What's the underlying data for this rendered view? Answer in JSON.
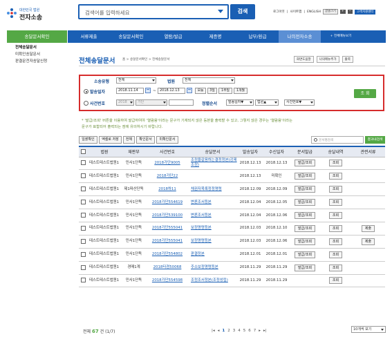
{
  "header": {
    "logo_small": "대한민국 법원",
    "logo_main": "전자소송",
    "search_placeholder": "검색어를 입력하세요",
    "search_button": "검색",
    "util_links": [
      "로그아웃",
      "사이트맵",
      "ENGLISH"
    ],
    "font_size_label": "글꼴크기",
    "font_plus": "+",
    "font_minus": "−",
    "customer_center": "고객지원센터"
  },
  "nav": {
    "items": [
      "서류제출",
      "송달문서확인",
      "열람/발급",
      "제증명",
      "납부/환급",
      "나의전자소송",
      "+ 전체메뉴보기"
    ],
    "active_index": 5
  },
  "sidebar": {
    "header": "송달문서확인",
    "items": [
      "전체송달문서",
      "미확인송달문서",
      "판결문전자송달신청"
    ],
    "current_index": 0
  },
  "page": {
    "title": "전체송달문서",
    "breadcrumb": "홈 > 송달문서확인 > 전체송달문서",
    "tools": [
      "화면도움말",
      "나의메뉴추가",
      "출력"
    ]
  },
  "filter": {
    "case_type_label": "소송유형",
    "case_type_value": "전체",
    "court_label": "법원",
    "court_value": "전체",
    "date_label": "발송일자",
    "date_from": "2018.11.14",
    "date_to": "2018.12.13",
    "date_sep": "~",
    "range_buttons": [
      "오늘",
      "3일",
      "1주일",
      "1개월"
    ],
    "case_no_label": "사건번호",
    "year_value": "2018",
    "case_kind_value": "가단",
    "sort_label": "정렬순서",
    "sort_options": [
      "발송일자▼",
      "법원▲",
      "사건번호▼"
    ],
    "lookup_button": "조 회"
  },
  "notice": [
    "* '발급/조회' 버튼을 이용하여 발급하여야 '열람용'이라는 문구가 기재되지 않은 등본을 출력할 수 있고, 그렇지 않은 경우는 '열람용'이라는",
    "  문구가 표함되어 출력되는 점에 유의하시기 바랍니다."
  ],
  "actions": {
    "buttons": [
      "일괄확인",
      "엑셀로 저장",
      "전체",
      "확인문서",
      "미확인문서"
    ],
    "search_placeholder": "문서명검색",
    "result_search": "결과내검색"
  },
  "table": {
    "headers": [
      "",
      "법원",
      "재판부",
      "사건번호",
      "송달문서",
      "발송일자",
      "수신일자",
      "문서발급",
      "송달내역",
      "관련서류"
    ],
    "issue_label": "발급/조회",
    "view_label": "조회",
    "submit_label": "제출",
    "rows": [
      {
        "court": "테스트테스트법원1",
        "division": "민사1단독",
        "case_no": "2018가단9005",
        "doc": "조정을갈음하는결정정본(강제조정)",
        "sent": "2018.12.13",
        "recv": "2018.12.13",
        "issue": true,
        "submit": false
      },
      {
        "court": "테스트테스트법원1",
        "division": "민사1단독",
        "case_no": "2018가단22",
        "doc": "",
        "sent": "2018.12.13",
        "recv": "미확인",
        "issue": true,
        "submit": false
      },
      {
        "court": "테스트테스트법원1",
        "division": "제1파산단독",
        "case_no": "2018하11",
        "doc": "채권자목록정정명령",
        "sent": "2018.12.09",
        "recv": "2018.12.09",
        "issue": true,
        "submit": false
      },
      {
        "court": "테스트테스트법원1",
        "division": "민사1단독",
        "case_no": "2018가단554619",
        "doc": "변론조서등본",
        "sent": "2018.12.04",
        "recv": "2018.12.05",
        "issue": true,
        "submit": false
      },
      {
        "court": "테스트테스트법원1",
        "division": "민사1단독",
        "case_no": "2018가단539100",
        "doc": "변론조서등본",
        "sent": "2018.12.04",
        "recv": "2018.12.06",
        "issue": true,
        "submit": false
      },
      {
        "court": "테스트테스트법원1",
        "division": "민사1단독",
        "case_no": "2018가단555041",
        "doc": "보정명령등본",
        "sent": "2018.12.03",
        "recv": "2018.12.10",
        "issue": true,
        "submit": true
      },
      {
        "court": "테스트테스트법원1",
        "division": "민사1단독",
        "case_no": "2018가단555041",
        "doc": "보정명령등본",
        "sent": "2018.12.03",
        "recv": "2018.12.06",
        "issue": true,
        "submit": true
      },
      {
        "court": "테스트테스트법원1",
        "division": "민사1단독",
        "case_no": "2018가단554802",
        "doc": "판결정본",
        "sent": "2018.12.01",
        "recv": "2018.12.01",
        "issue": true,
        "submit": false
      },
      {
        "court": "테스트테스트법원1",
        "division": "경매1계",
        "case_no": "2018타경50068",
        "doc": "주소보정명령등본",
        "sent": "2018.11.29",
        "recv": "2018.11.29",
        "issue": true,
        "submit": false
      },
      {
        "court": "테스트테스트법원1",
        "division": "민사1단독",
        "case_no": "2018가단554598",
        "doc": "조정조서정본(조정성립)",
        "sent": "2018.11.29",
        "recv": "2018.11.29",
        "issue": false,
        "submit": false
      }
    ]
  },
  "footer": {
    "total_prefix": "전체",
    "total_count": "67",
    "total_suffix": "건 (1/7)",
    "pages": [
      "1",
      "2",
      "3",
      "4",
      "5",
      "6",
      "7"
    ],
    "per_page": "10개씩 보기"
  },
  "colors": {
    "primary": "#1a5fb4",
    "green": "#54a845",
    "highlight_border": "#d62b2b"
  }
}
